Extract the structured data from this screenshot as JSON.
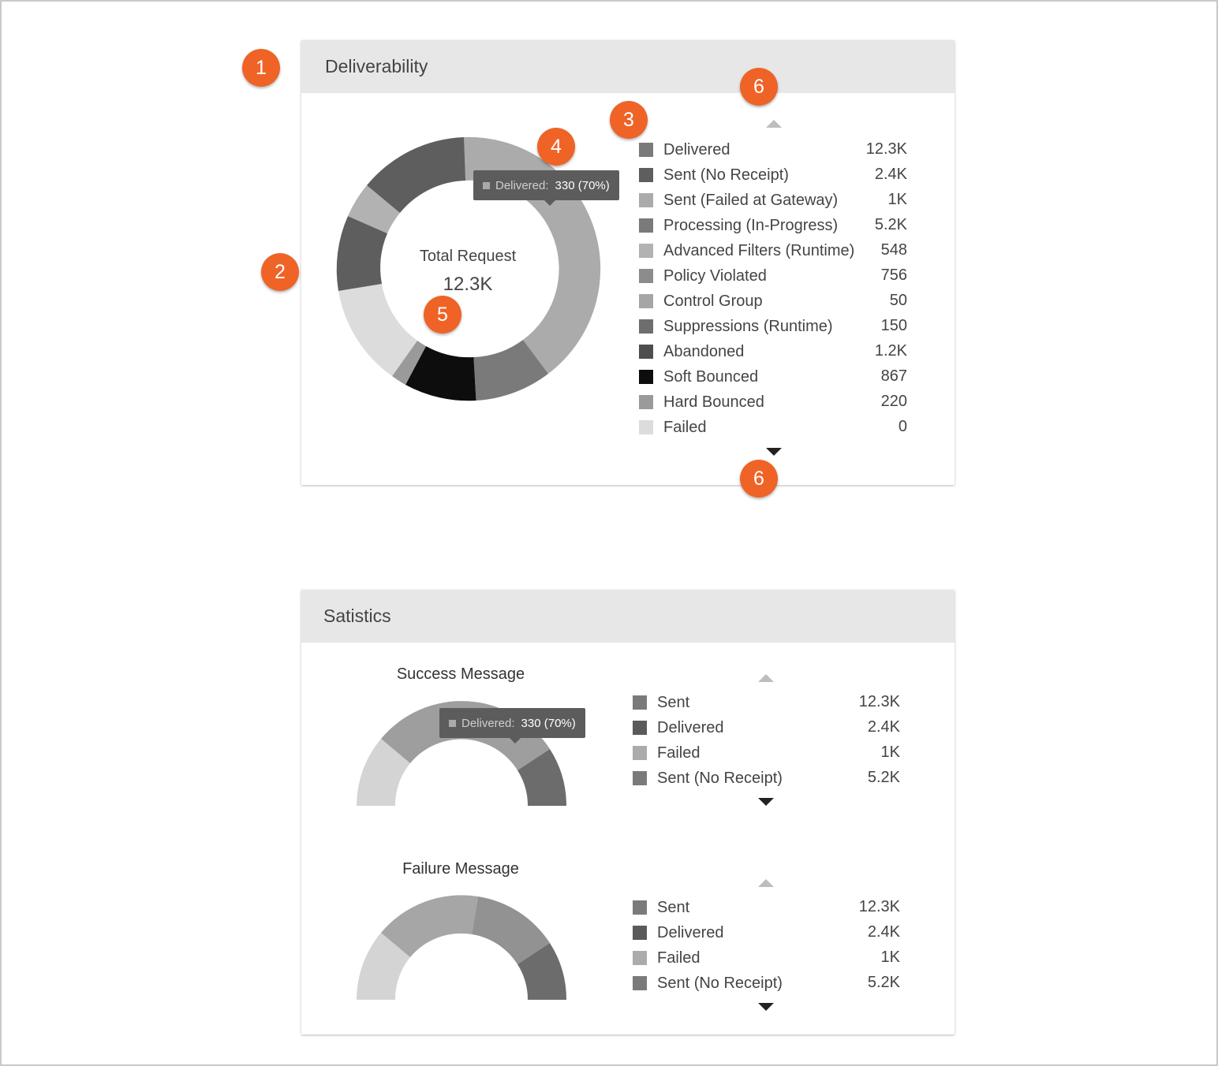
{
  "deliverability": {
    "title": "Deliverability",
    "center_label": "Total Request",
    "center_value": "12.3K",
    "tooltip": {
      "label": "Delivered:",
      "value": "330 (70%)"
    },
    "legend": [
      {
        "label": "Delivered",
        "value": "12.3K",
        "color": "#7a7a7a"
      },
      {
        "label": "Sent (No Receipt)",
        "value": "2.4K",
        "color": "#5e5e5e"
      },
      {
        "label": "Sent (Failed at Gateway)",
        "value": "1K",
        "color": "#ababab"
      },
      {
        "label": "Processing (In-Progress)",
        "value": "5.2K",
        "color": "#7a7a7a"
      },
      {
        "label": "Advanced Filters (Runtime)",
        "value": "548",
        "color": "#b2b2b2"
      },
      {
        "label": "Policy Violated",
        "value": "756",
        "color": "#8c8c8c"
      },
      {
        "label": "Control Group",
        "value": "50",
        "color": "#a6a6a6"
      },
      {
        "label": "Suppressions (Runtime)",
        "value": "150",
        "color": "#6e6e6e"
      },
      {
        "label": "Abandoned",
        "value": "1.2K",
        "color": "#4e4e4e"
      },
      {
        "label": "Soft Bounced",
        "value": "867",
        "color": "#0d0d0d"
      },
      {
        "label": "Hard Bounced",
        "value": "220",
        "color": "#9a9a9a"
      },
      {
        "label": "Failed",
        "value": "0",
        "color": "#dcdcdc"
      }
    ]
  },
  "statistics": {
    "title": "Satistics",
    "success": {
      "title": "Success Message",
      "tooltip": {
        "label": "Delivered:",
        "value": "330 (70%)"
      },
      "legend": [
        {
          "label": "Sent",
          "value": "12.3K",
          "color": "#7a7a7a"
        },
        {
          "label": "Delivered",
          "value": "2.4K",
          "color": "#5a5a5a"
        },
        {
          "label": "Failed",
          "value": "1K",
          "color": "#ababab"
        },
        {
          "label": "Sent (No Receipt)",
          "value": "5.2K",
          "color": "#7a7a7a"
        }
      ]
    },
    "failure": {
      "title": "Failure Message",
      "legend": [
        {
          "label": "Sent",
          "value": "12.3K",
          "color": "#7a7a7a"
        },
        {
          "label": "Delivered",
          "value": "2.4K",
          "color": "#5a5a5a"
        },
        {
          "label": "Failed",
          "value": "1K",
          "color": "#ababab"
        },
        {
          "label": "Sent (No Receipt)",
          "value": "5.2K",
          "color": "#7a7a7a"
        }
      ]
    }
  },
  "annotations": [
    "1",
    "2",
    "3",
    "4",
    "5",
    "6",
    "6"
  ]
}
